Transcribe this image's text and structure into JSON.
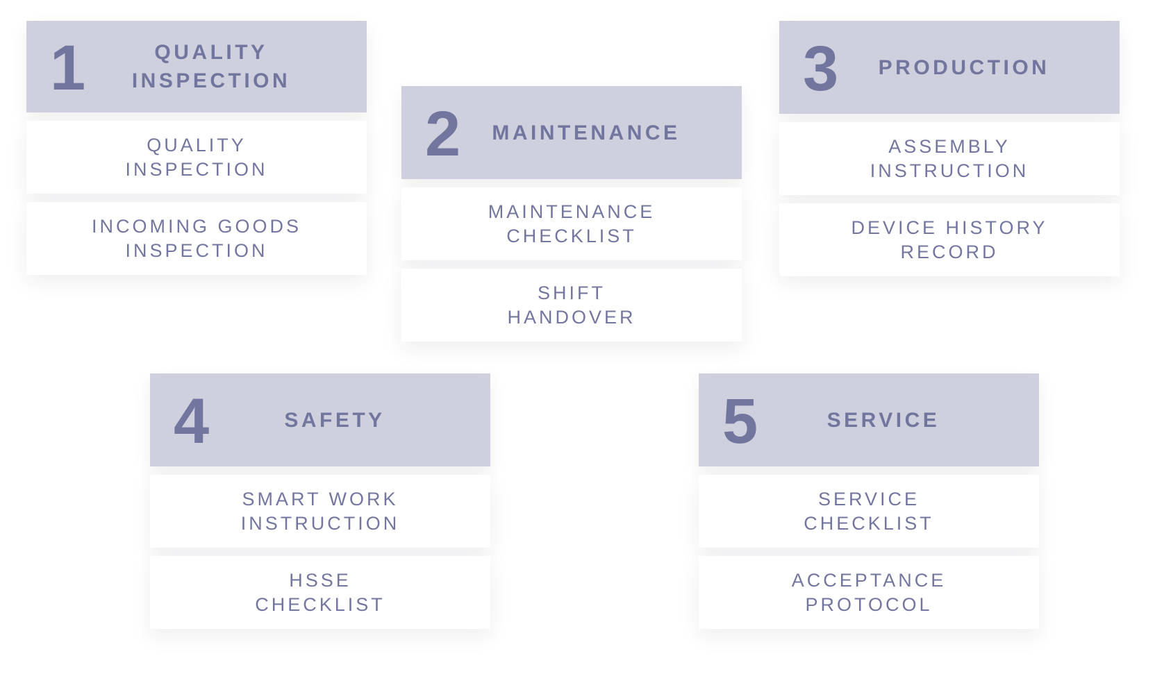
{
  "colors": {
    "header_bg": "#cfd0de",
    "text": "#72759e",
    "item_bg": "#ffffff",
    "page_bg": "#ffffff"
  },
  "categories": [
    {
      "number": "1",
      "title": "QUALITY\nINSPECTION",
      "items": [
        "QUALITY\nINSPECTION",
        "INCOMING GOODS\nINSPECTION"
      ]
    },
    {
      "number": "2",
      "title": "MAINTENANCE",
      "items": [
        "MAINTENANCE\nCHECKLIST",
        "SHIFT\nHANDOVER"
      ]
    },
    {
      "number": "3",
      "title": "PRODUCTION",
      "items": [
        "ASSEMBLY\nINSTRUCTION",
        "DEVICE HISTORY\nRECORD"
      ]
    },
    {
      "number": "4",
      "title": "SAFETY",
      "items": [
        "SMART WORK\nINSTRUCTION",
        "HSSE\nCHECKLIST"
      ]
    },
    {
      "number": "5",
      "title": "SERVICE",
      "items": [
        "SERVICE\nCHECKLIST",
        "ACCEPTANCE\nPROTOCOL"
      ]
    }
  ]
}
